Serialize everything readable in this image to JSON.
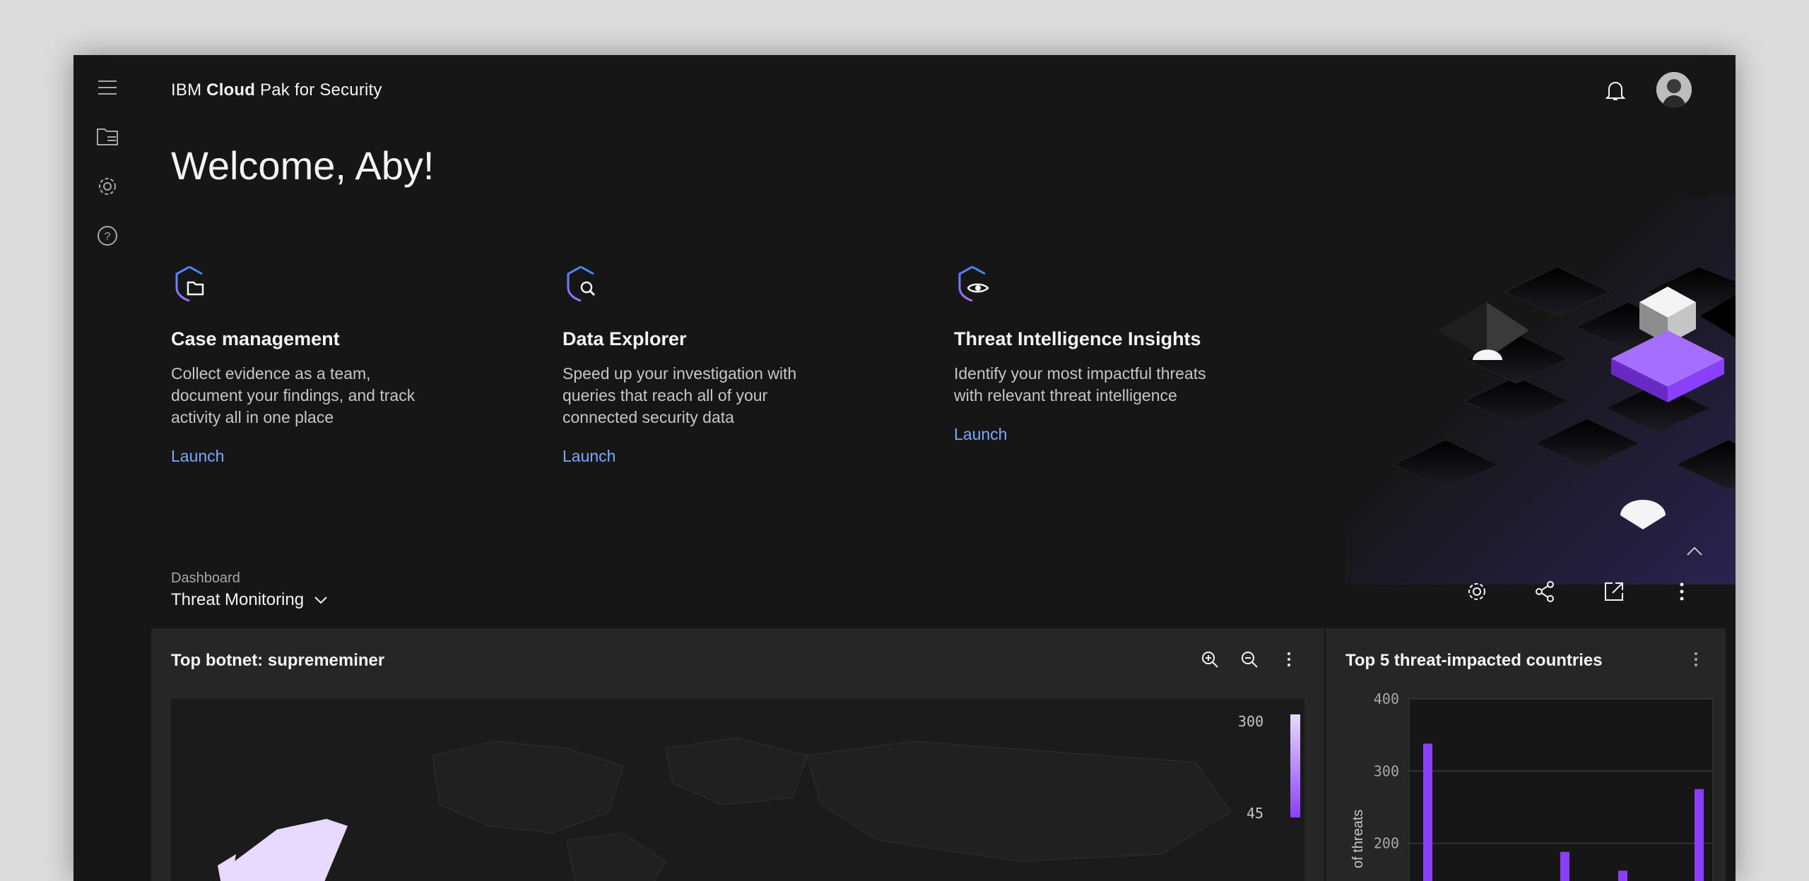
{
  "header": {
    "brand_prefix": "IBM",
    "brand_bold": "Cloud",
    "brand_suffix": "Pak for Security"
  },
  "welcome": "Welcome, Aby!",
  "cards": [
    {
      "title": "Case management",
      "desc": "Collect evidence as a team, document your findings, and track activity all in one place",
      "link": "Launch",
      "icon": "case-folder-shield-icon"
    },
    {
      "title": "Data Explorer",
      "desc": "Speed up your investigation with queries that reach all of your connected security data",
      "link": "Launch",
      "icon": "search-shield-icon"
    },
    {
      "title": "Threat Intelligence Insights",
      "desc": "Identify your most impactful threats with relevant threat intelligence",
      "link": "Launch",
      "icon": "eye-shield-icon"
    }
  ],
  "dashboard": {
    "label": "Dashboard",
    "selected": "Threat Monitoring"
  },
  "tiles": {
    "map": {
      "title": "Top botnet: suprememiner",
      "legend_max": "300",
      "legend_min": "45"
    },
    "countries": {
      "title": "Top 5 threat-impacted countries"
    }
  },
  "colors": {
    "accent": "#8a3ffc",
    "link": "#78a9ff",
    "background": "#161616",
    "tile": "#262626"
  },
  "chart_data": {
    "type": "bar",
    "ylabel": "of threats",
    "ylim": [
      100,
      400
    ],
    "yticks": [
      "400",
      "300",
      "200"
    ],
    "values": [
      338,
      188,
      162,
      275
    ],
    "grid": true
  }
}
